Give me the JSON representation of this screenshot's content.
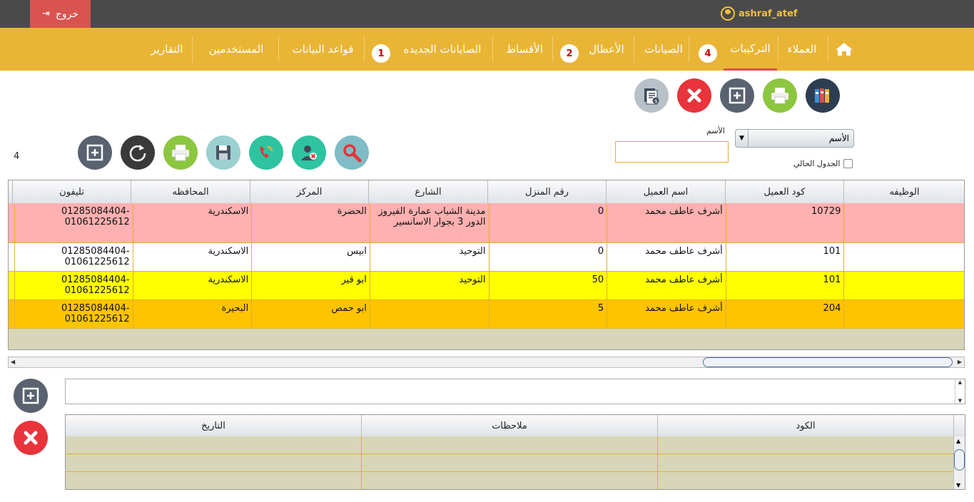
{
  "topbar": {
    "logout_label": "خروج",
    "username": "ashraf_atef"
  },
  "nav": {
    "items": [
      {
        "label": "العملاء"
      },
      {
        "label": "التركيبات",
        "badge": "4",
        "active": true
      },
      {
        "label": "الصيانات"
      },
      {
        "label": "الأعطال",
        "badge": "2"
      },
      {
        "label": "الأقساط"
      },
      {
        "label": "الصايانات الجديده",
        "badge": "1"
      },
      {
        "label": "قواعد البيانات"
      },
      {
        "label": "المستخدمين"
      },
      {
        "label": "التقارير"
      }
    ]
  },
  "toolbar_top": {
    "icons": [
      "binders-icon",
      "printer-icon",
      "add-square-icon",
      "close-x-icon",
      "invoice-money-icon"
    ]
  },
  "toolbar_main": {
    "icons": [
      "search-icon",
      "remove-user-icon",
      "phone-refresh-icon",
      "save-disk-icon",
      "printer-icon",
      "refresh-icon",
      "add-square-icon"
    ]
  },
  "search": {
    "field_label": "الأسم",
    "select_value": "الأسم",
    "input_value": "",
    "current_table_label": "الجدول الحالي"
  },
  "record_count": "4",
  "grid": {
    "columns": [
      "الوظيفه",
      "كود العميل",
      "اسم العميل",
      "رقم المنزل",
      "الشارع",
      "المركز",
      "المحافظه",
      "تليفون"
    ],
    "rows": [
      {
        "color": "#ffb0b0",
        "job": "",
        "code": "10729",
        "name": "أشرف عاطف محمد",
        "house": "0",
        "street": "مدينة الشباب عمارة الفيروز الدور 3 بجوار الاسانسير",
        "center": "الحضرة",
        "governorate": "الاسكندرية",
        "phone": "01285084404-01061225612"
      },
      {
        "color": "#ffffff",
        "job": "",
        "code": "101",
        "name": "أشرف عاطف محمد",
        "house": "0",
        "street": "التوحيد",
        "center": "ابيس",
        "governorate": "الاسكندرية",
        "phone": "01285084404-01061225612"
      },
      {
        "color": "#ffff00",
        "job": "",
        "code": "101",
        "name": "أشرف عاطف محمد",
        "house": "50",
        "street": "التوحيد",
        "center": "ابو قير",
        "governorate": "الاسكندرية",
        "phone": "01285084404-01061225612"
      },
      {
        "color": "#ffc400",
        "job": "",
        "code": "204",
        "name": "أشرف عاطف محمد",
        "house": "5",
        "street": "",
        "center": "ابو حمص",
        "governorate": "البحيرة",
        "phone": "01285084404-01061225612"
      }
    ]
  },
  "notes": {
    "input_value": "",
    "columns": [
      "الكود",
      "ملاحظات",
      "التاريخ"
    ]
  },
  "colors": {
    "topbar": "#4a4a4a",
    "navbar": "#e9b535",
    "logout": "#d9534f",
    "accent_red": "#e8343a"
  }
}
